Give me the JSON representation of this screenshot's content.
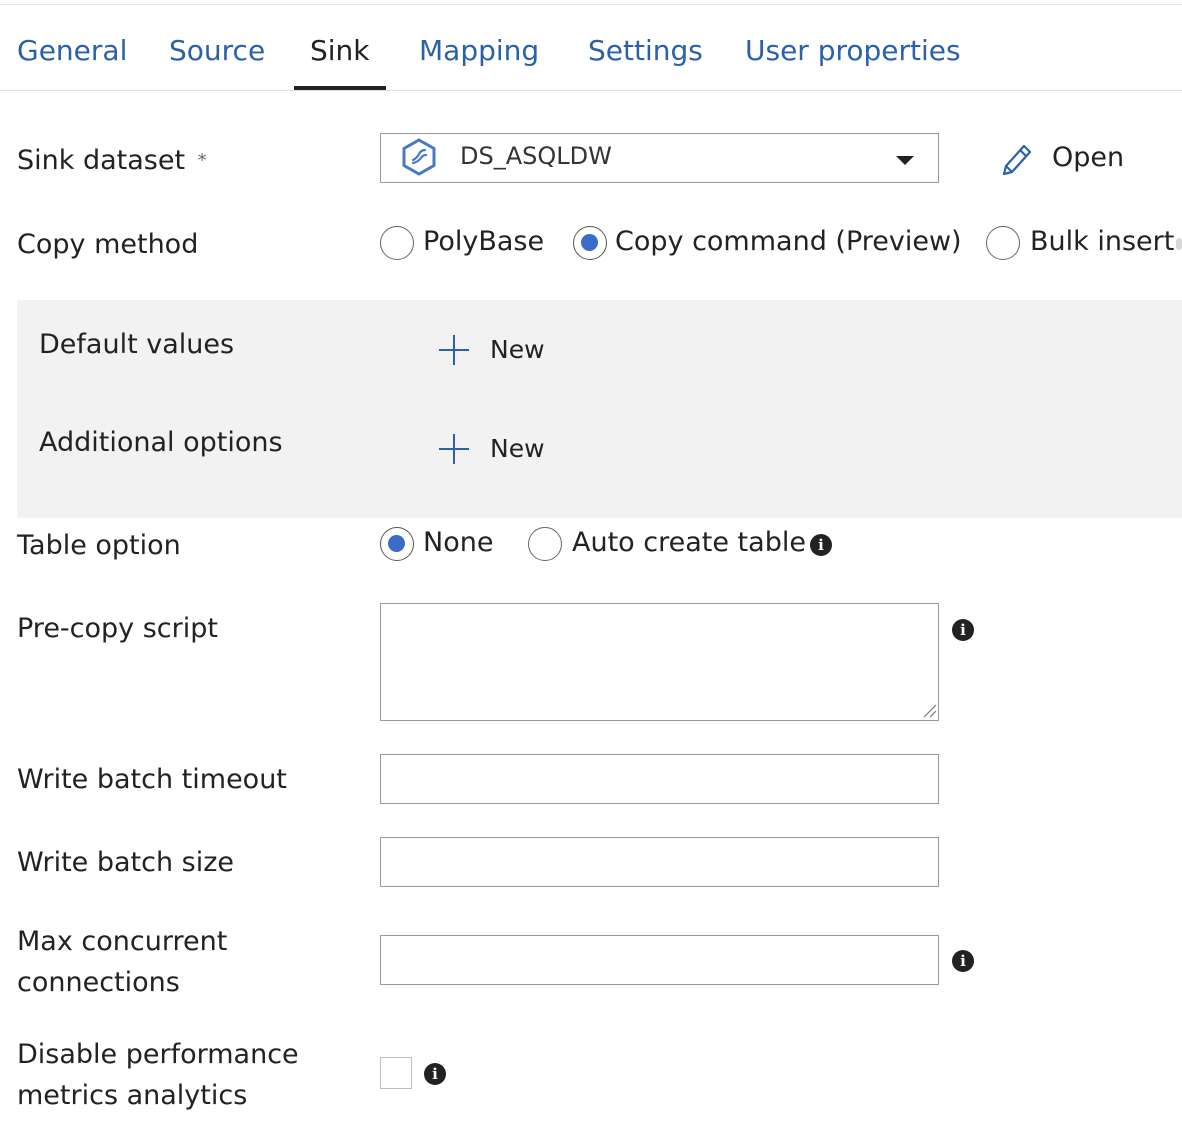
{
  "tabs": [
    {
      "label": "General"
    },
    {
      "label": "Source"
    },
    {
      "label": "Sink",
      "active": true
    },
    {
      "label": "Mapping"
    },
    {
      "label": "Settings"
    },
    {
      "label": "User properties"
    }
  ],
  "sink_dataset": {
    "label": "Sink dataset",
    "required_mark": "*",
    "value": "DS_ASQLDW",
    "open_label": "Open"
  },
  "copy_method": {
    "label": "Copy method",
    "options": [
      {
        "label": "PolyBase",
        "selected": false
      },
      {
        "label": "Copy command (Preview)",
        "selected": true
      },
      {
        "label": "Bulk insert",
        "selected": false
      }
    ]
  },
  "default_values": {
    "label": "Default values",
    "new_label": "New"
  },
  "additional_options": {
    "label": "Additional options",
    "new_label": "New"
  },
  "table_option": {
    "label": "Table option",
    "options": [
      {
        "label": "None",
        "selected": true
      },
      {
        "label": "Auto create table",
        "selected": false
      }
    ]
  },
  "pre_copy_script": {
    "label": "Pre-copy script",
    "value": ""
  },
  "write_batch_timeout": {
    "label": "Write batch timeout",
    "value": ""
  },
  "write_batch_size": {
    "label": "Write batch size",
    "value": ""
  },
  "max_concurrent_connections": {
    "label_line1": "Max concurrent",
    "label_line2": "connections",
    "value": ""
  },
  "disable_performance_metrics": {
    "label_line1": "Disable performance",
    "label_line2": "metrics analytics",
    "checked": false
  },
  "colors": {
    "accent": "#3a6bc9",
    "tab_link": "#2b61a8",
    "panel_bg": "#f2f2f2"
  }
}
